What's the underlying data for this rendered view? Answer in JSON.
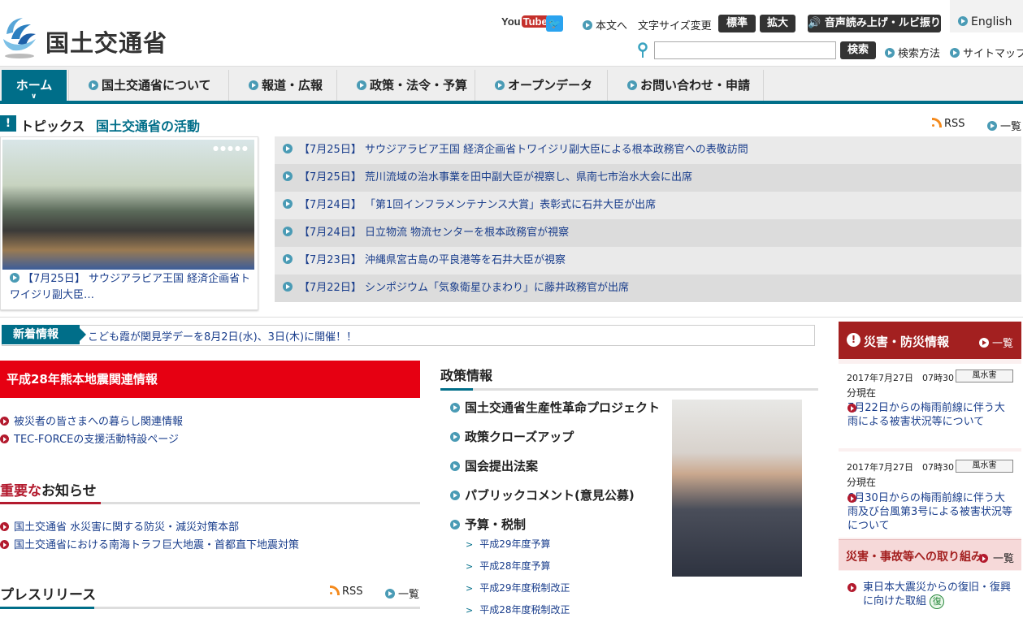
{
  "header": {
    "logo_text": "国土交通省",
    "youtube_you": "You",
    "youtube_tube": "Tube",
    "twitter_glyph": "🐦",
    "skip_label": "本文へ",
    "font_size_label": "文字サイズ変更",
    "font_standard": "標準",
    "font_large": "拡大",
    "voice_label": "音声読み上げ・ルビ振り",
    "english_label": "English",
    "search_value": "",
    "search_button": "検索",
    "search_method": "検索方法",
    "sitemap": "サイトマップ"
  },
  "nav": {
    "home": "ホーム",
    "items": [
      "国土交通省について",
      "報道・広報",
      "政策・法令・予算",
      "オープンデータ",
      "お問い合わせ・申請"
    ]
  },
  "topics": {
    "title": "トピックス",
    "subtitle": "国土交通省の活動",
    "rss": "RSS",
    "list_all": "一覧",
    "photo_caption": "【7月25日】 サウジアラビア王国 経済企画省トワイジリ副大臣…",
    "news": [
      "【7月25日】 サウジアラビア王国 経済企画省トワイジリ副大臣による根本政務官への表敬訪問",
      "【7月25日】 荒川流域の治水事業を田中副大臣が視察し、県南七市治水大会に出席",
      "【7月24日】 「第1回インフラメンテナンス大賞」表彰式に石井大臣が出席",
      "【7月24日】 日立物流 物流センターを根本政務官が視察",
      "【7月23日】 沖縄県宮古島の平良港等を石井大臣が視察",
      "【7月22日】 シンポジウム「気象衛星ひまわり」に藤井政務官が出席"
    ]
  },
  "new_info": {
    "label": "新着情報",
    "text": "こども霞が関見学デーを8月2日(水)、3日(木)に開催！！"
  },
  "kumamoto": {
    "title": "平成28年熊本地震関連情報",
    "links": [
      "被災者の皆さまへの暮らし関連情報",
      "TEC-FORCEの支援活動特設ページ"
    ]
  },
  "important": {
    "title_red": "重要な",
    "title_rest": "お知らせ",
    "links": [
      "国土交通省 水災害に関する防災・減災対策本部",
      "国土交通省における南海トラフ巨大地震・首都直下地震対策"
    ]
  },
  "press": {
    "title": "プレスリリース",
    "rss": "RSS",
    "list_all": "一覧"
  },
  "policy": {
    "title": "政策情報",
    "items": [
      "国土交通省生産性革命プロジェクト",
      "政策クローズアップ",
      "国会提出法案",
      "パブリックコメント(意見公募)",
      "予算・税制"
    ],
    "sub_items": [
      "平成29年度予算",
      "平成28年度予算",
      "平成29年度税制改正",
      "平成28年度税制改正"
    ]
  },
  "disaster": {
    "title": "災害・防災情報",
    "list_all": "一覧",
    "entries": [
      {
        "date": "2017年7月27日　07時30",
        "suffix": "分現在",
        "tag": "風水害",
        "link": "7月22日からの梅雨前線に伴う大雨による被害状況等について"
      },
      {
        "date": "2017年7月27日　07時30",
        "suffix": "分現在",
        "tag": "風水害",
        "link": "6月30日からの梅雨前線に伴う大雨及び台風第3号による被害状況等について"
      }
    ],
    "accident_title": "災害・事故等への取り組み",
    "accident_list": "一覧",
    "recovery_link": "東日本大震災からの復旧・復興に向けた取組",
    "recovery_badge": "復"
  }
}
